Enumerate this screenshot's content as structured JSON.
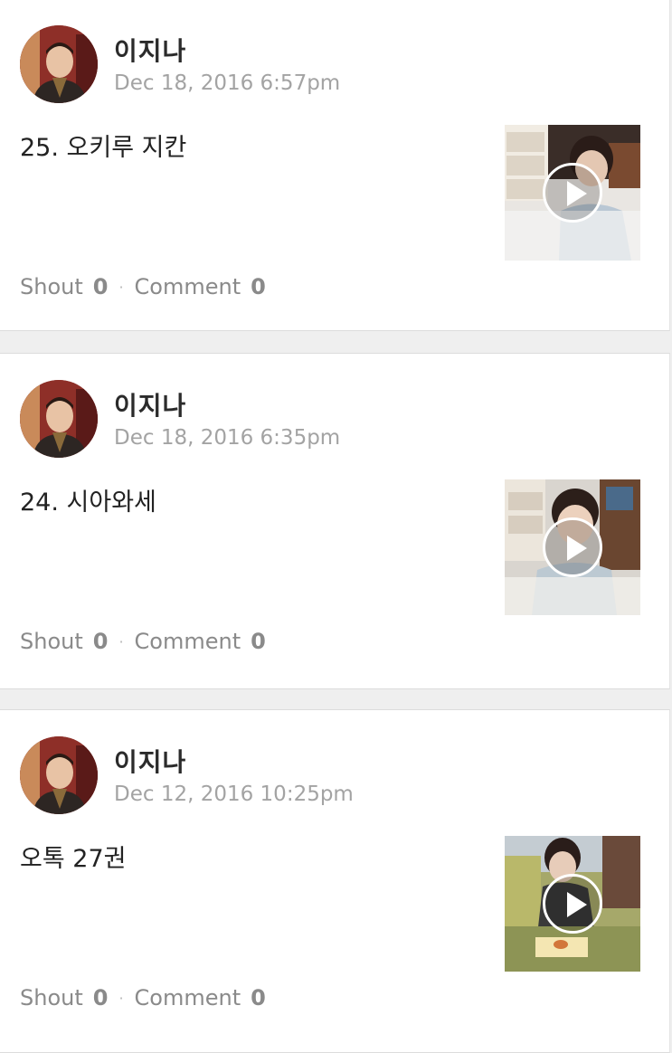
{
  "posts": [
    {
      "author": "이지나",
      "date": "Dec 18, 2016 6:57pm",
      "title": "25. 오키루 지칸",
      "shout_label": "Shout",
      "shout_count": "0",
      "comment_label": "Comment",
      "comment_count": "0",
      "separator": "·"
    },
    {
      "author": "이지나",
      "date": "Dec 18, 2016 6:35pm",
      "title": "24. 시아와세",
      "shout_label": "Shout",
      "shout_count": "0",
      "comment_label": "Comment",
      "comment_count": "0",
      "separator": "·"
    },
    {
      "author": "이지나",
      "date": "Dec 12, 2016 10:25pm",
      "title": "오톡 27권",
      "shout_label": "Shout",
      "shout_count": "0",
      "comment_label": "Comment",
      "comment_count": "0",
      "separator": "·"
    }
  ],
  "colors": {
    "background": "#efefef",
    "card": "#ffffff",
    "meta": "#a3a3a3",
    "stats": "#8a8a8a"
  }
}
